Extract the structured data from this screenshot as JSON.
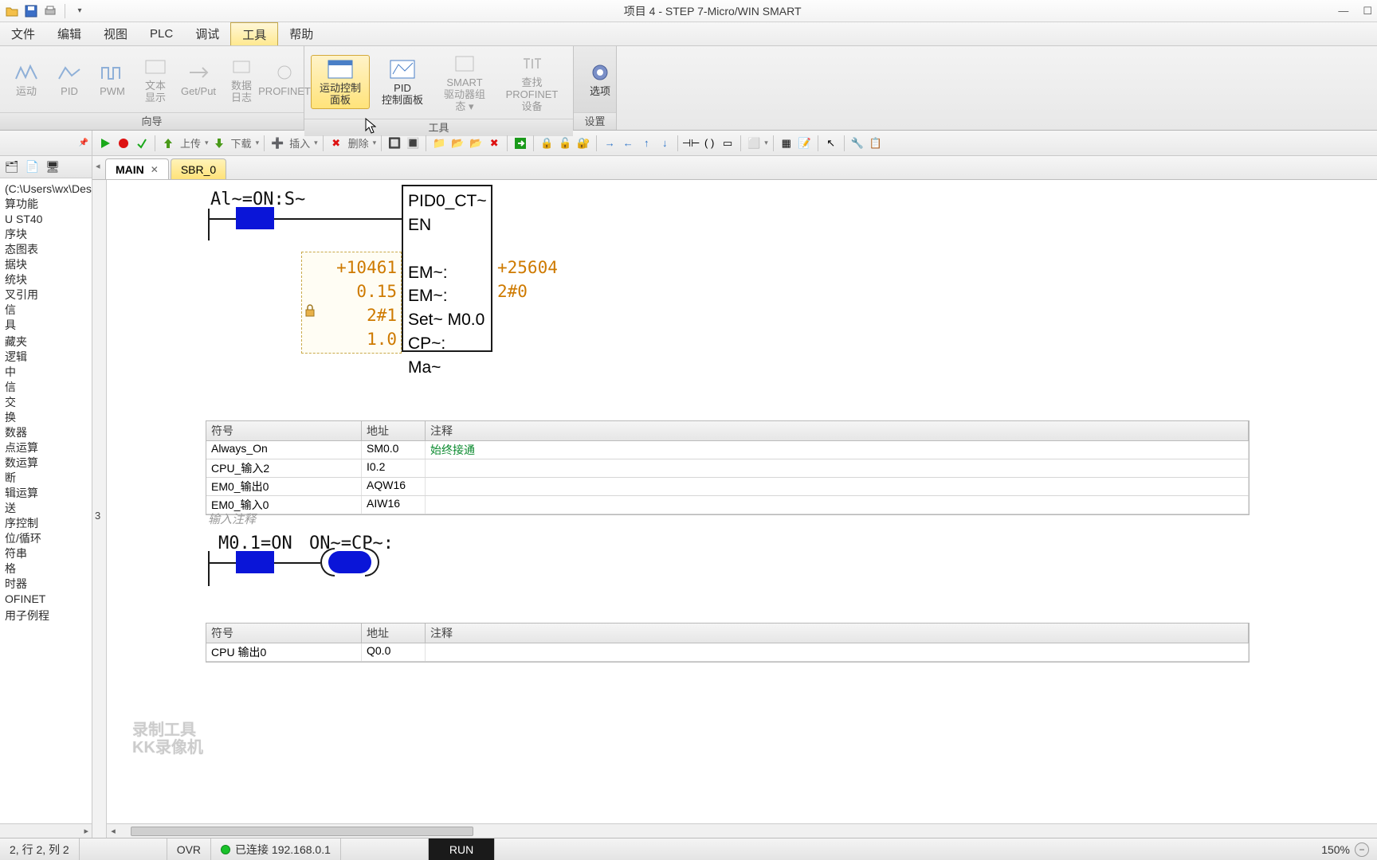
{
  "titlebar": {
    "title": "项目 4 - STEP 7-Micro/WIN SMART"
  },
  "menu": {
    "file": "文件",
    "edit": "编辑",
    "view": "视图",
    "plc": "PLC",
    "debug": "调试",
    "tools": "工具",
    "help": "帮助"
  },
  "ribbon": {
    "group_wizard": "向导",
    "group_tools": "工具",
    "group_settings": "设置",
    "motion": "运动",
    "pid": "PID",
    "pwm": "PWM",
    "textdisp": "文本显示",
    "getput": "Get/Put",
    "datalog": "数据日志",
    "profinet": "PROFINET",
    "motion_panel": "运动控制面板",
    "pid_panel_l1": "PID",
    "pid_panel_l2": "控制面板",
    "smart_l1": "SMART",
    "smart_l2": "驱动器组态 ▾",
    "find_l1": "查找",
    "find_l2": "PROFINET 设备",
    "options": "选项"
  },
  "toolbar": {
    "upload": "上传",
    "download": "下载",
    "insert": "插入",
    "delete": "删除"
  },
  "sidebar": {
    "path": "(C:\\Users\\wx\\Deskt…",
    "items": [
      "算功能",
      "U ST40",
      "序块",
      "态图表",
      "据块",
      "统块",
      "叉引用",
      "信",
      "具",
      "",
      "藏夹",
      "逻辑",
      "中",
      "信",
      "交",
      "换",
      "数器",
      "点运算",
      "数运算",
      "断",
      "辑运算",
      "送",
      "序控制",
      "位/循环",
      "符串",
      "格",
      "时器",
      "OFINET",
      "",
      "用子例程"
    ]
  },
  "tabs": {
    "main": "MAIN",
    "sbr": "SBR_0"
  },
  "net1": {
    "contact_label": "Al~=ON:S~",
    "fb_title": "PID0_CT~",
    "fb_en": "EN",
    "in1": "+10461",
    "in2": "0.15",
    "in3": "2#1",
    "in4": "1.0",
    "row1": "EM~: EM~:",
    "row2": "Set~   M0.0",
    "row3": "CP~:",
    "row4": "Ma~",
    "out1": "+25604",
    "out2": "2#0"
  },
  "symtable": {
    "hdr_sym": "符号",
    "hdr_addr": "地址",
    "hdr_cmt": "注释",
    "rows": [
      {
        "sym": "Always_On",
        "addr": "SM0.0",
        "cmt": "始终接通"
      },
      {
        "sym": "CPU_输入2",
        "addr": "I0.2",
        "cmt": ""
      },
      {
        "sym": "EM0_输出0",
        "addr": "AQW16",
        "cmt": ""
      },
      {
        "sym": "EM0_输入0",
        "addr": "AIW16",
        "cmt": ""
      }
    ]
  },
  "net3": {
    "num": "3",
    "comment": "输入注释",
    "label": "M0.1=ON",
    "label2": "ON~=CP~:"
  },
  "symtable2": {
    "row0_sym": "CPU 输出0",
    "row0_addr": "Q0.0"
  },
  "status": {
    "pos": "2, 行 2, 列 2",
    "ovr": "OVR",
    "conn": "已连接 192.168.0.1",
    "run": "RUN",
    "zoom": "150%"
  },
  "watermark": {
    "l1": "录制工具",
    "l2": "KK录像机"
  }
}
